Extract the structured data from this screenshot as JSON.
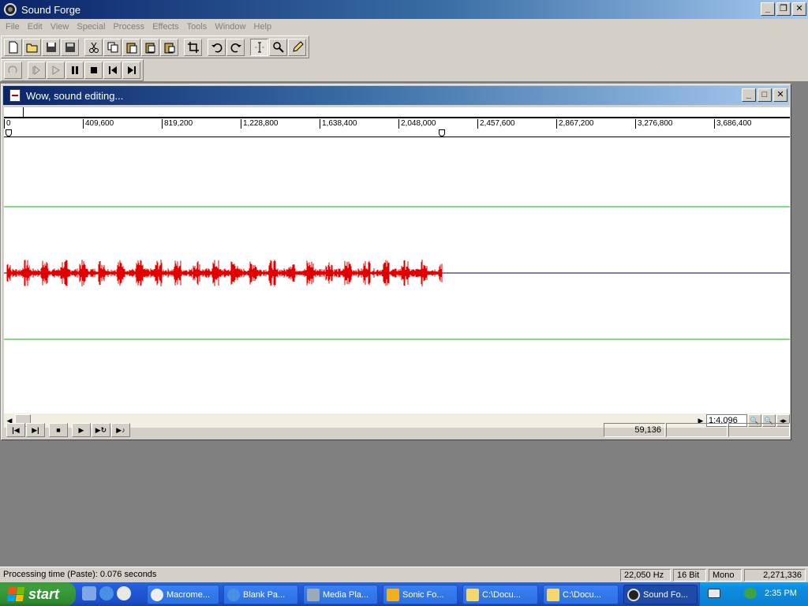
{
  "app": {
    "title": "Sound Forge",
    "window_buttons": [
      "_",
      "❐",
      "✕"
    ]
  },
  "menu": [
    "File",
    "Edit",
    "View",
    "Special",
    "Process",
    "Effects",
    "Tools",
    "Window",
    "Help"
  ],
  "document": {
    "title": "Wow, sound editing...",
    "ruler_labels": [
      "0",
      "409,600",
      "819,200",
      "1,228,800",
      "1,638,400",
      "2,048,000",
      "2,457,600",
      "2,867,200",
      "3,276,800",
      "3,686,400"
    ],
    "zoom": "1:4,096",
    "position": "59,136",
    "waveform_color": "#e00000",
    "guide_color": "#00c000"
  },
  "status": {
    "message": "Processing time (Paste): 0.076 seconds",
    "sample_rate": "22,050 Hz",
    "bit_depth": "16 Bit",
    "channels": "Mono",
    "length": "2,271,336"
  },
  "taskbar": {
    "start_label": "start",
    "tasks": [
      "Macrome...",
      "Blank Pa...",
      "Media Pla...",
      "Sonic Fo...",
      "C:\\Docu...",
      "C:\\Docu...",
      "Sound Fo..."
    ],
    "clock": "2:35 PM"
  }
}
